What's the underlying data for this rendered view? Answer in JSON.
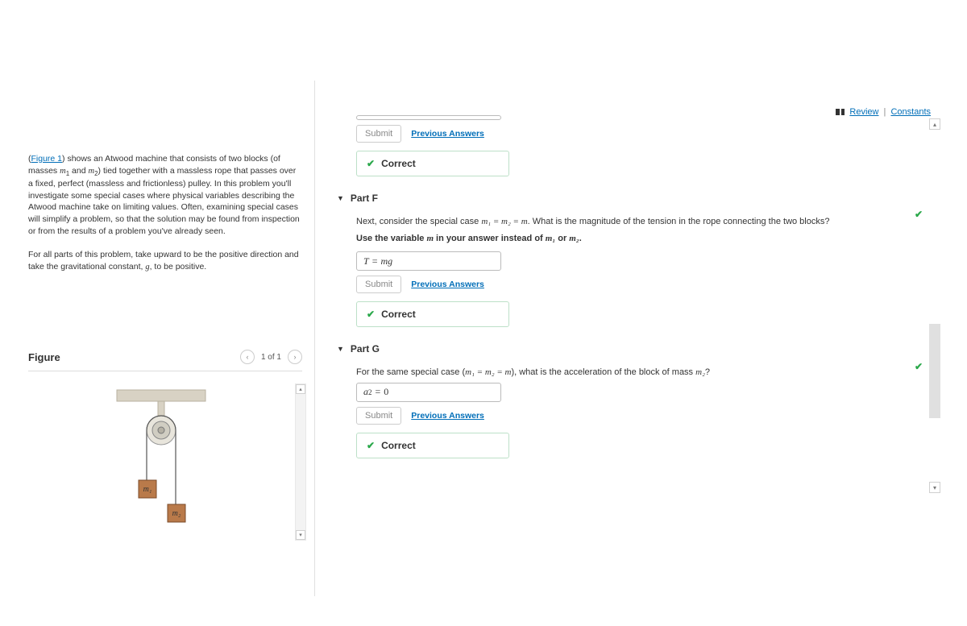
{
  "header": {
    "review_link": "Review",
    "constants_link": "Constants"
  },
  "intro": {
    "figure_link": "Figure 1",
    "para1_before": "(",
    "para1_after": ") shows an Atwood machine that consists of two blocks (of masses ",
    "m1_var": "m",
    "m1_sub": "1",
    "and_text": " and ",
    "m2_var": "m",
    "m2_sub": "2",
    "para1_c": ") tied together with a massless rope that passes over a fixed, perfect (massless and frictionless) pulley. In this problem you'll investigate some special cases where physical variables describing the Atwood machine take on limiting values. Often, examining special cases will simplify a problem, so that the solution may be found from inspection or from the results of a problem you've already seen.",
    "para2_a": "For all parts of this problem, take upward to be the positive direction and take the gravitational constant, ",
    "g_var": "g",
    "para2_b": ", to be positive."
  },
  "figure": {
    "heading": "Figure",
    "page": "1 of 1",
    "m1_label": "m₁",
    "m2_label": "m₂"
  },
  "partE": {
    "submit": "Submit",
    "prev": "Previous Answers",
    "correct": "Correct"
  },
  "partF": {
    "label": "Part F",
    "q_a": "Next, consider the special case ",
    "q_eq": "m₁ = m₂ = m",
    "q_b": ". What is the magnitude of the tension in the rope connecting the two blocks?",
    "instr_a": "Use the variable ",
    "instr_m": "m",
    "instr_b": " in your answer instead of ",
    "instr_m1": "m₁",
    "instr_or": " or ",
    "instr_m2": "m₂",
    "instr_end": ".",
    "answer_lhs": "T",
    "answer_eq": "=",
    "answer_rhs": "mg",
    "submit": "Submit",
    "prev": "Previous Answers",
    "correct": "Correct"
  },
  "partG": {
    "label": "Part G",
    "q_a": "For the same special case (",
    "q_eq": "m₁ = m₂ = m",
    "q_b": "), what is the acceleration of the block of mass ",
    "q_m2": "m₂",
    "q_c": "?",
    "answer_lhs": "a",
    "answer_sub": "2",
    "answer_eq": "=",
    "answer_rhs": "0",
    "submit": "Submit",
    "prev": "Previous Answers",
    "correct": "Correct"
  }
}
